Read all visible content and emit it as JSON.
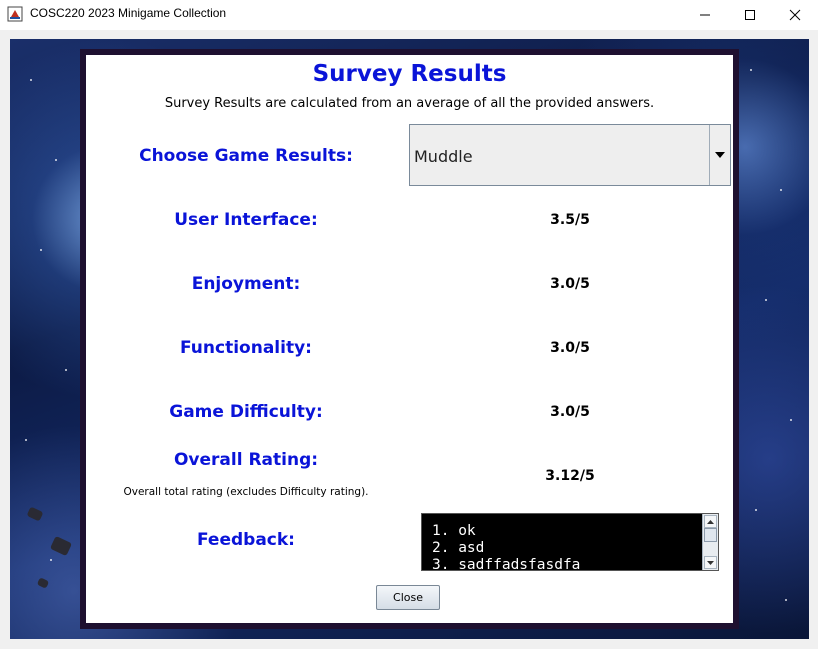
{
  "window": {
    "title": "COSC220 2023 Minigame Collection",
    "icons": {
      "app": "java-cup-icon",
      "minimize": "minimize-icon",
      "maximize": "maximize-icon",
      "close": "close-icon"
    }
  },
  "survey": {
    "title": "Survey Results",
    "subtitle": "Survey Results are calculated from an average of all the provided answers.",
    "choose_label": "Choose Game Results:",
    "selected_game": "Muddle",
    "rows": [
      {
        "label": "User Interface:",
        "value": "3.5/5"
      },
      {
        "label": "Enjoyment:",
        "value": "3.0/5"
      },
      {
        "label": "Functionality:",
        "value": "3.0/5"
      },
      {
        "label": "Game Difficulty:",
        "value": "3.0/5"
      }
    ],
    "overall": {
      "label": "Overall Rating:",
      "note": "Overall total rating (excludes Difficulty rating).",
      "value": "3.12/5"
    },
    "feedback": {
      "label": "Feedback:",
      "items": [
        "1. ok",
        "2. asd",
        "3. sadffadsfasdfa"
      ]
    },
    "close_label": "Close"
  },
  "colors": {
    "accent_blue": "#0a14d8",
    "panel_border": "#1e1030",
    "feedback_bg": "#000000"
  }
}
